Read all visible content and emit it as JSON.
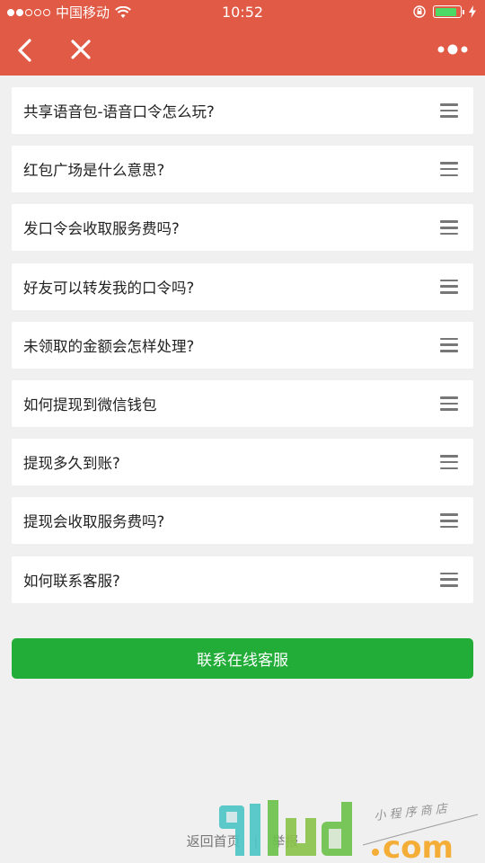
{
  "status_bar": {
    "carrier": "中国移动",
    "time": "10:52",
    "battery_level": 0.9
  },
  "nav": {
    "back_icon": "chevron-left-icon",
    "close_icon": "close-icon",
    "more_icon": "more-dots-icon"
  },
  "faq": {
    "items": [
      {
        "label": "共享语音包-语音口令怎么玩?"
      },
      {
        "label": "红包广场是什么意思?"
      },
      {
        "label": "发口令会收取服务费吗?"
      },
      {
        "label": "好友可以转发我的口令吗?"
      },
      {
        "label": "未领取的金额会怎样处理?"
      },
      {
        "label": "如何提现到微信钱包"
      },
      {
        "label": "提现多久到账?"
      },
      {
        "label": "提现会收取服务费吗?"
      },
      {
        "label": "如何联系客服?"
      }
    ]
  },
  "service_button": {
    "label": "联系在线客服"
  },
  "footer": {
    "home_link": "返回首页",
    "separator": "|",
    "report_link": "举报"
  },
  "watermark": {
    "logo": "91ud.com",
    "tagline": "小 程 序 商 店"
  },
  "colors": {
    "header": "#e05a45",
    "button": "#22ac38",
    "background": "#f0f0f0"
  }
}
